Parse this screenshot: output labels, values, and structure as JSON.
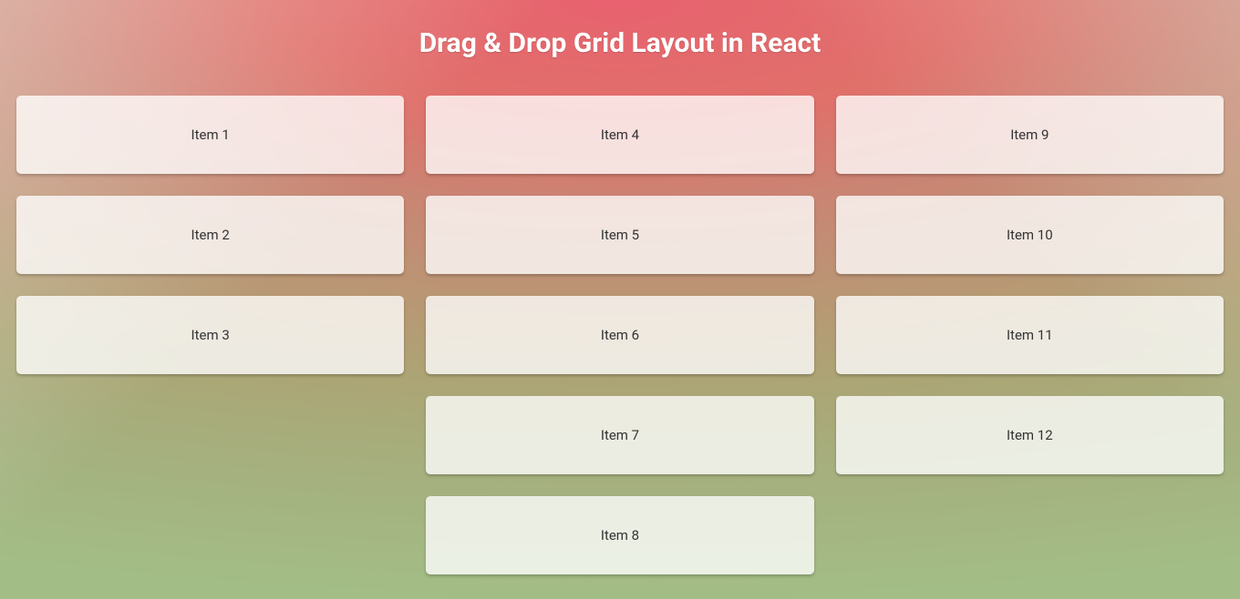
{
  "title": "Drag & Drop Grid Layout in React",
  "columns": [
    {
      "items": [
        "Item 1",
        "Item 2",
        "Item 3"
      ]
    },
    {
      "items": [
        "Item 4",
        "Item 5",
        "Item 6",
        "Item 7",
        "Item 8"
      ]
    },
    {
      "items": [
        "Item 9",
        "Item 10",
        "Item 11",
        "Item 12"
      ]
    }
  ]
}
